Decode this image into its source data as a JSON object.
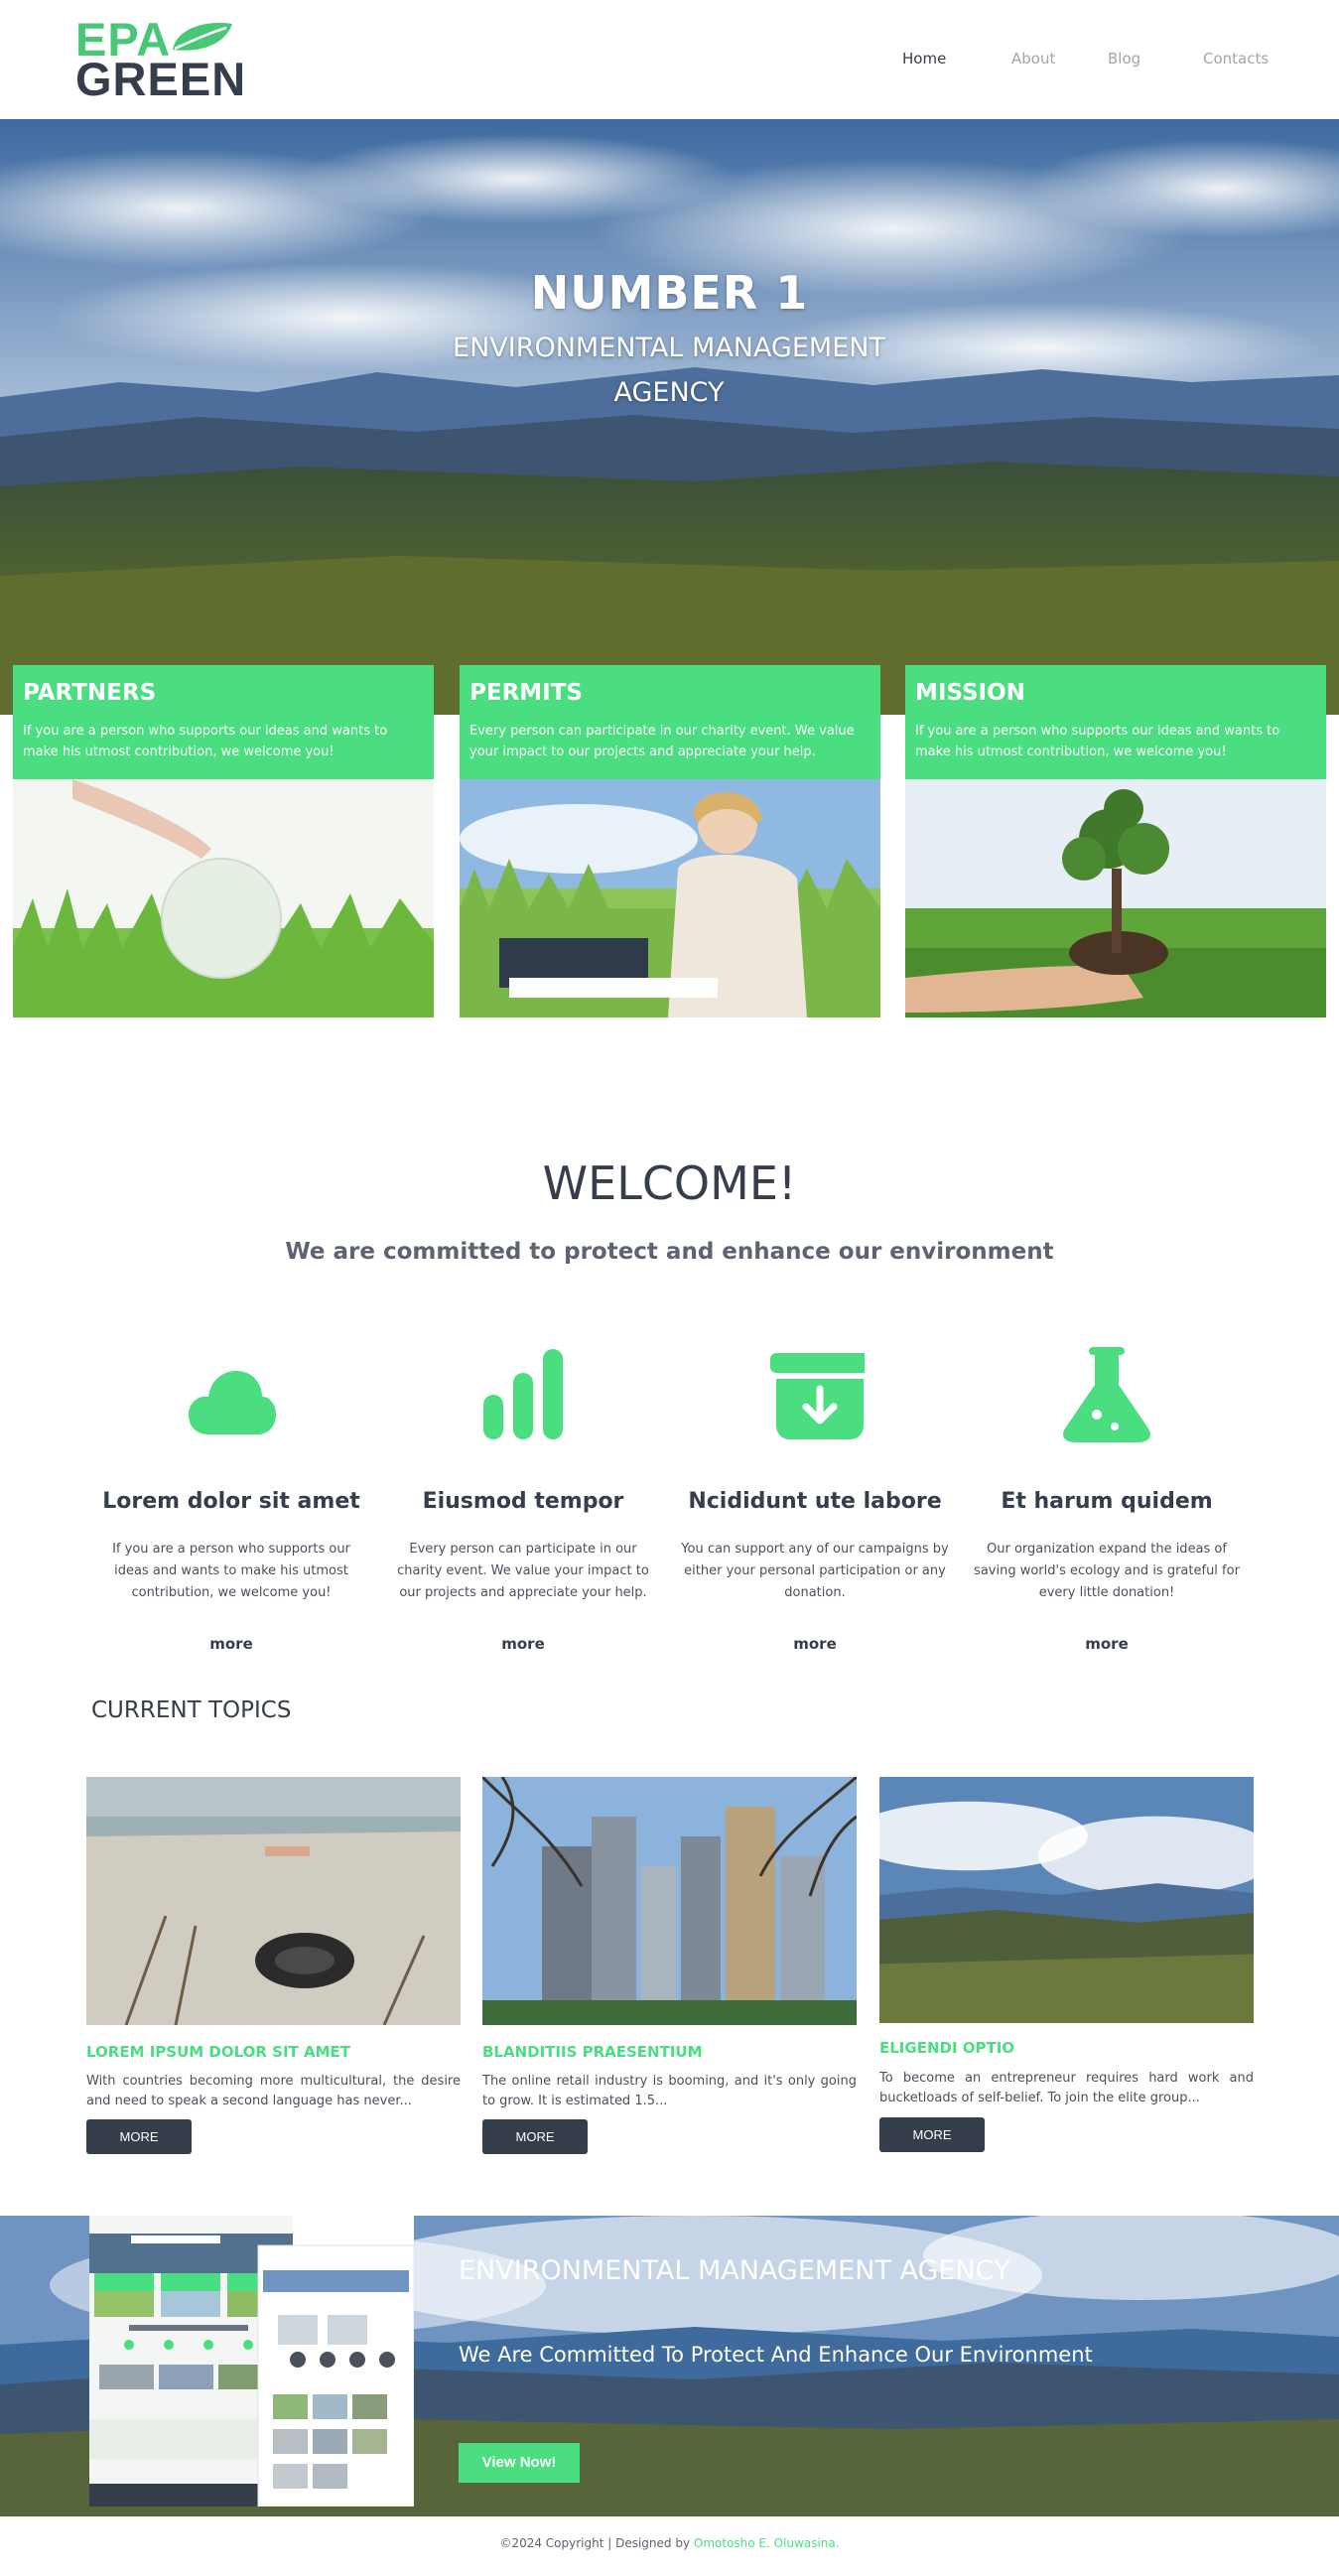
{
  "colors": {
    "accent": "#4ade80",
    "dark": "#363d4b",
    "muted": "#a2a5ab"
  },
  "logo": {
    "line1": "EPA",
    "line2": "GREEN",
    "icon": "leaf-icon"
  },
  "nav": {
    "items": [
      "Home",
      "About",
      "Blog",
      "Contacts"
    ],
    "active": "Home"
  },
  "hero": {
    "title": "NUMBER 1",
    "subtitle": "ENVIRONMENTAL MANAGEMENT AGENCY"
  },
  "cards": [
    {
      "title": "PARTNERS",
      "text": "If you are a person who supports our ideas and wants to make his utmost contribution, we welcome you!",
      "image": "globe-in-grass"
    },
    {
      "title": "PERMITS",
      "text": "Every person can participate in our charity event. We value your impact to our projects and appreciate your help.",
      "image": "woman-with-laptop"
    },
    {
      "title": "MISSION",
      "text": "If you are a person who supports our ideas and wants to make his utmost contribution, we welcome you!",
      "image": "hand-holding-tree"
    }
  ],
  "welcome": {
    "title": "WELCOME!",
    "subtitle": "We are committed to protect and enhance our environment"
  },
  "features": [
    {
      "icon": "cloud-icon",
      "title": "Lorem dolor sit amet",
      "text": "If you are a person who supports our ideas and wants to make his utmost contribution, we welcome you!",
      "more": "more"
    },
    {
      "icon": "bar-chart-icon",
      "title": "Eiusmod tempor",
      "text": "Every person can participate in our charity event. We value your impact to our projects and appreciate your help.",
      "more": "more"
    },
    {
      "icon": "archive-download-icon",
      "title": "Ncididunt ute labore",
      "text": "You can support any of our campaigns by either your personal participation or any donation.",
      "more": "more"
    },
    {
      "icon": "flask-icon",
      "title": "Et harum quidem",
      "text": "Our organization expand the ideas of saving world's ecology and is grateful for every little donation!",
      "more": "more"
    }
  ],
  "topics": {
    "title": "CURRENT TOPICS",
    "items": [
      {
        "title": "LOREM IPSUM DOLOR SIT AMET",
        "text": "With countries becoming more multicultural, the desire and need to speak a second language has never...",
        "button": "MORE",
        "image": "beach-with-tire"
      },
      {
        "title": "BLANDITIIS PRAESENTIUM",
        "text": "The online retail industry is booming, and it's only going to grow. It is estimated 1.5...",
        "button": "MORE",
        "image": "skyscrapers"
      },
      {
        "title": "ELIGENDI OPTIO",
        "text": "To become an entrepreneur requires hard work and bucketloads of self-belief. To join the elite group...",
        "button": "MORE",
        "image": "landscape-clouds"
      }
    ]
  },
  "banner": {
    "title": "ENVIRONMENTAL MANAGEMENT AGENCY",
    "subtitle": "We Are Committed To Protect And Enhance Our Environment",
    "button": "View Now!"
  },
  "footer": {
    "text": "©2024 Copyright | Designed by ",
    "link": "Omotosho E. Oluwasina."
  }
}
